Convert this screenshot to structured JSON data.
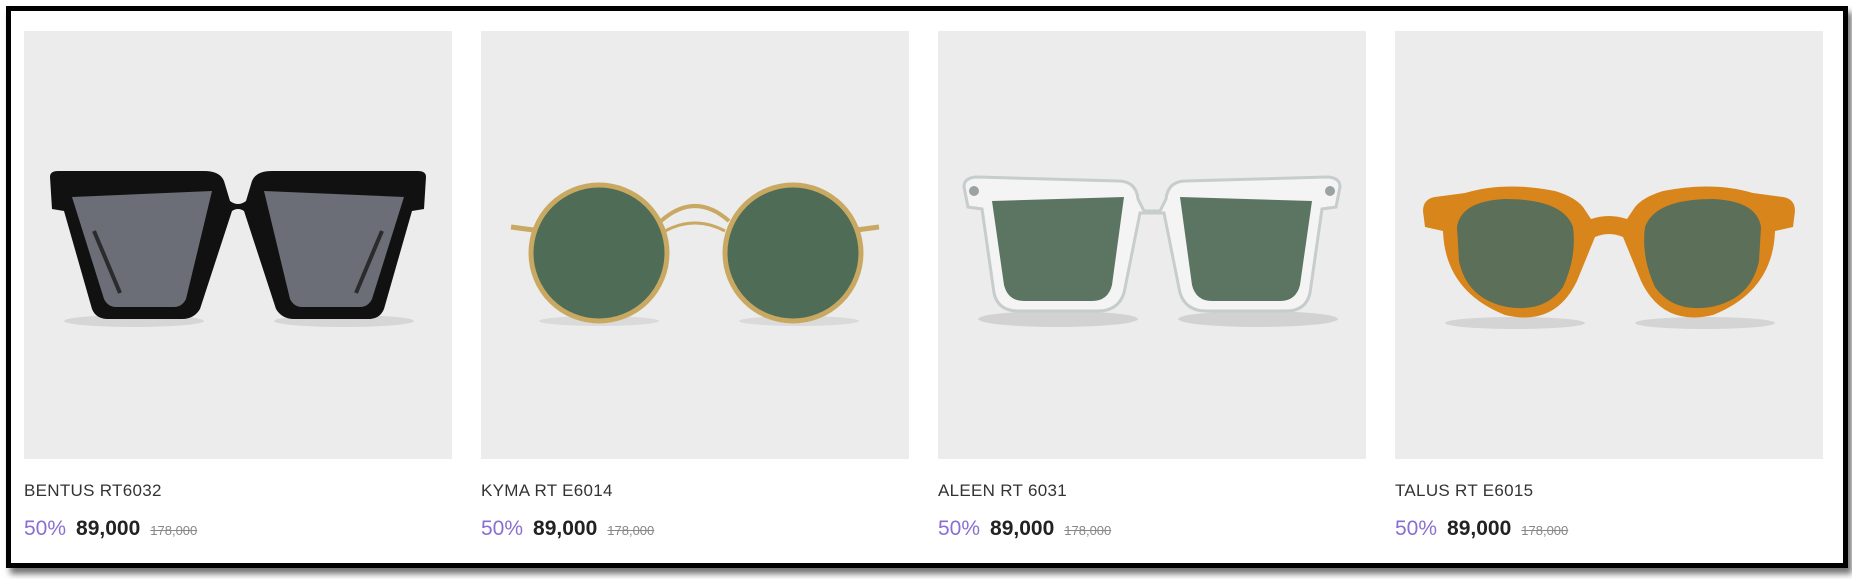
{
  "products": [
    {
      "name": "BENTUS RT6032",
      "discount": "50%",
      "price": "89,000",
      "old_price": "178,000",
      "icon": "black-square-sunglasses",
      "colors": {
        "frame": "#111111",
        "lens": "#6b6d77"
      }
    },
    {
      "name": "KYMA RT E6014",
      "discount": "50%",
      "price": "89,000",
      "old_price": "178,000",
      "icon": "gold-round-sunglasses",
      "colors": {
        "frame": "#c9a962",
        "lens": "#4f6c57"
      }
    },
    {
      "name": "ALEEN RT 6031",
      "discount": "50%",
      "price": "89,000",
      "old_price": "178,000",
      "icon": "clear-frame-sunglasses",
      "colors": {
        "frame": "#d8dcdc",
        "lens": "#5c7563"
      }
    },
    {
      "name": "TALUS RT E6015",
      "discount": "50%",
      "price": "89,000",
      "old_price": "178,000",
      "icon": "amber-round-sunglasses",
      "colors": {
        "frame": "#d8861c",
        "lens": "#5c6f58"
      }
    }
  ],
  "colors": {
    "discount": "#8a6fd1",
    "price": "#222222",
    "old_price": "#888888",
    "thumb_bg": "#ececec"
  }
}
